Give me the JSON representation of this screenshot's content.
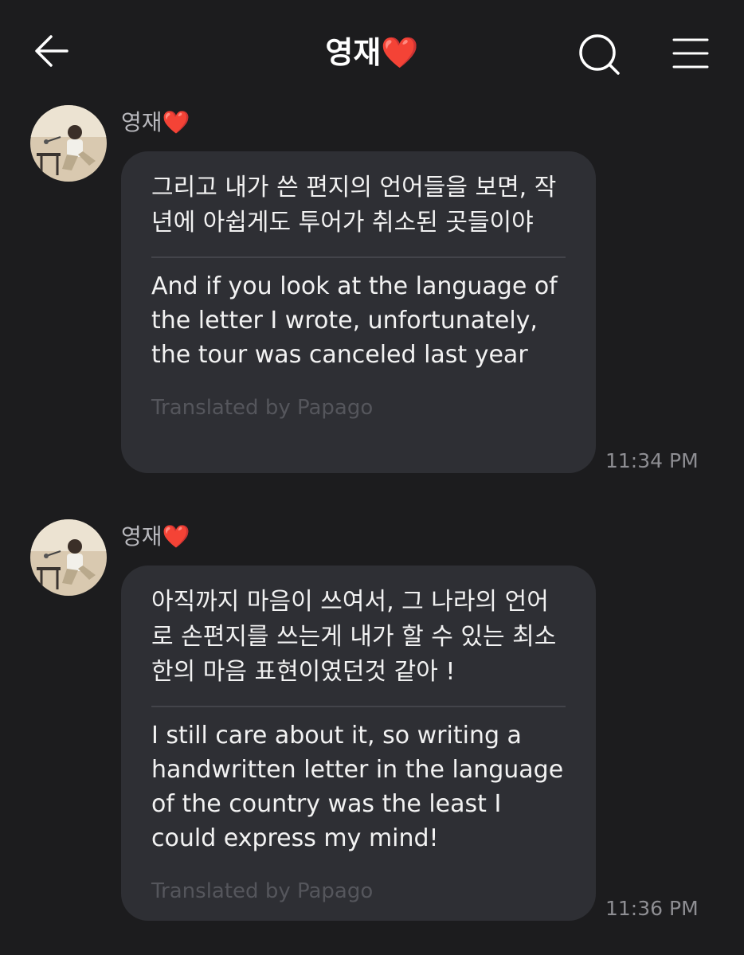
{
  "header": {
    "title": "영재",
    "title_emoji": "❤️",
    "back_icon": "arrow-left-icon",
    "search_icon": "search-icon",
    "menu_icon": "menu-icon"
  },
  "messages": [
    {
      "sender": "영재",
      "sender_emoji": "❤️",
      "original": "그리고 내가 쓴 편지의 언어들을 보면, 작년에 아쉽게도 투어가 취소된 곳들이야",
      "translation": "And if you look at the language of the letter I wrote, unfortunately, the tour was canceled last year",
      "credit": "Translated by Papago",
      "time": "11:34 PM"
    },
    {
      "sender": "영재",
      "sender_emoji": "❤️",
      "original": "아직까지 마음이 쓰여서, 그 나라의 언어로 손편지를 쓰는게 내가 할 수 있는 최소한의 마음 표현이였던것 같아 !",
      "translation": "I still care about it, so writing a handwritten letter in the language of the country was the least I could express my mind!",
      "credit": "Translated by Papago",
      "time": "11:36 PM"
    }
  ],
  "colors": {
    "background": "#1c1c1e",
    "bubble": "#2e2f34",
    "heart": "#ff2d2d",
    "timestamp": "#8e8e93",
    "credit": "#55565c"
  }
}
